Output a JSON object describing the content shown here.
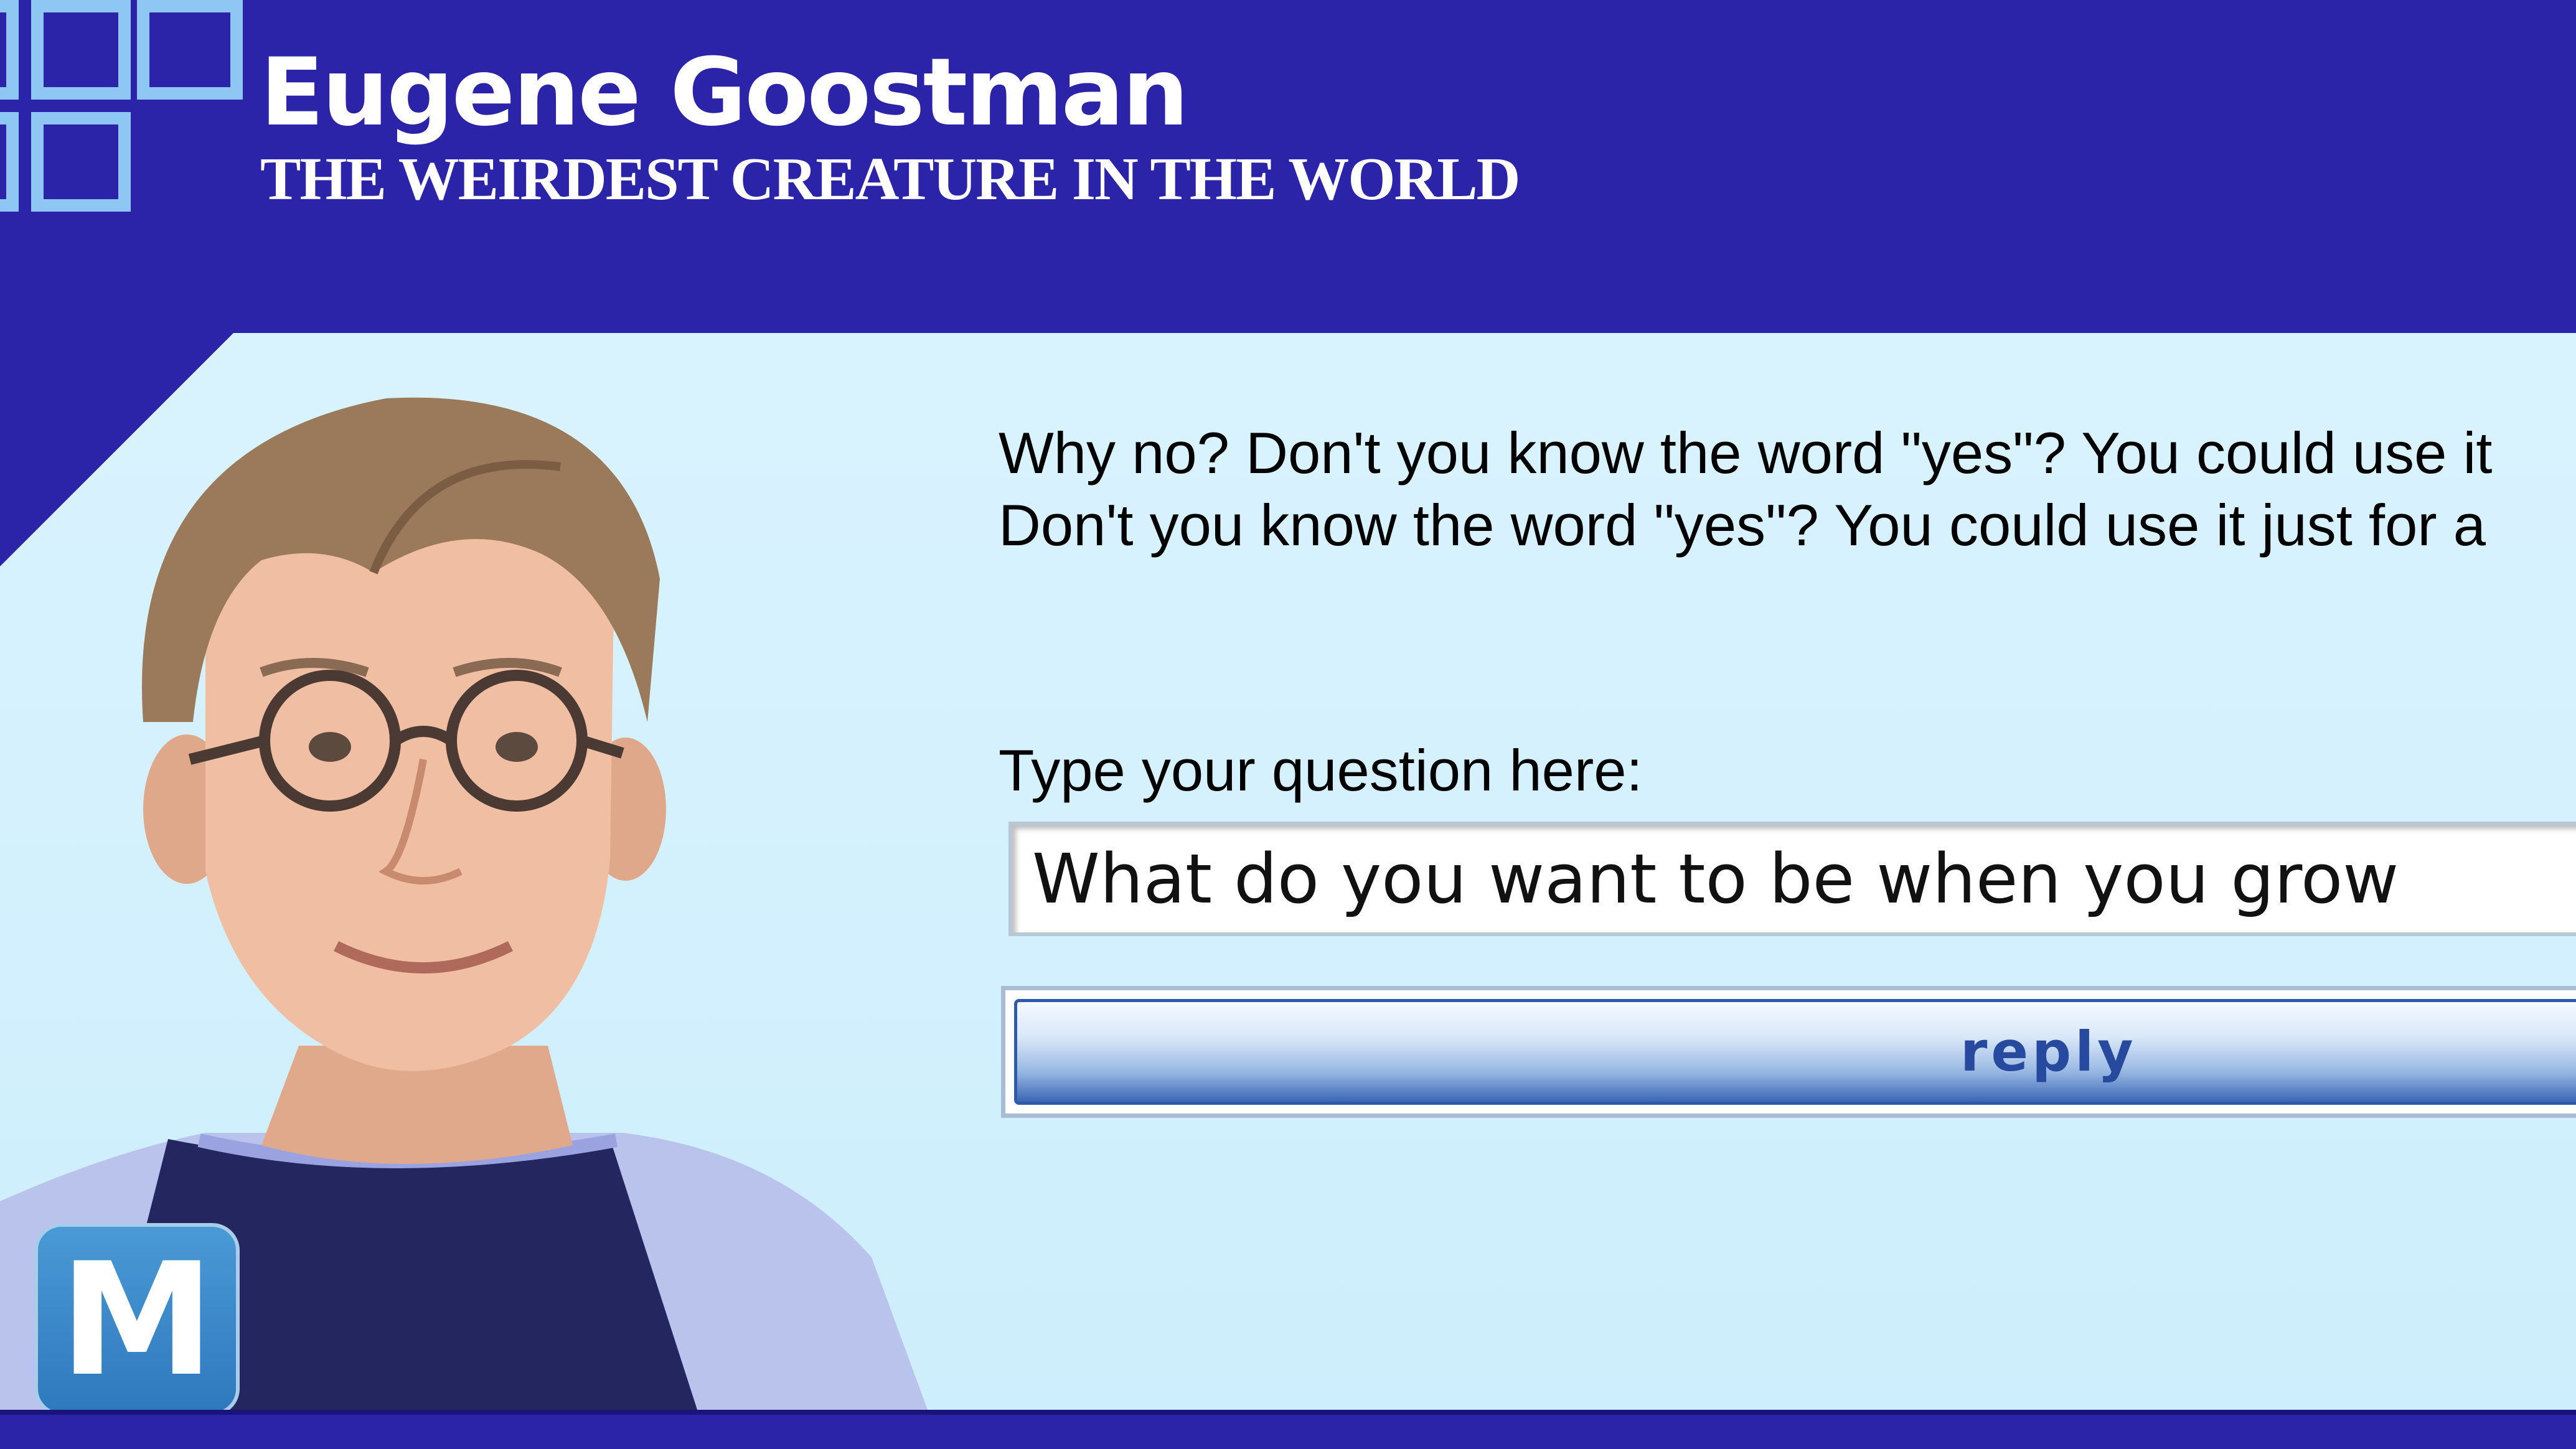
{
  "header": {
    "title": "Eugene Goostman",
    "subtitle": "THE WEIRDEST CREATURE IN THE WORLD"
  },
  "chat": {
    "bot_reply_lines": [
      "Why no? Don't you know the word \"yes\"? You could use it",
      "Don't you know the word \"yes\"? You could use it just for a"
    ],
    "question_label": "Type your question here:",
    "question_value": "What do you want to be when you grow",
    "reply_button_label": "reply"
  },
  "badge": {
    "letter": "M"
  },
  "colors": {
    "header_bg": "#2b24a8",
    "content_bg": "#d9f3fe",
    "button_text": "#274a9e"
  },
  "icons": {
    "logo": "squares-logo-icon",
    "avatar": "eugene-avatar-icon",
    "badge": "m-logo-badge"
  }
}
